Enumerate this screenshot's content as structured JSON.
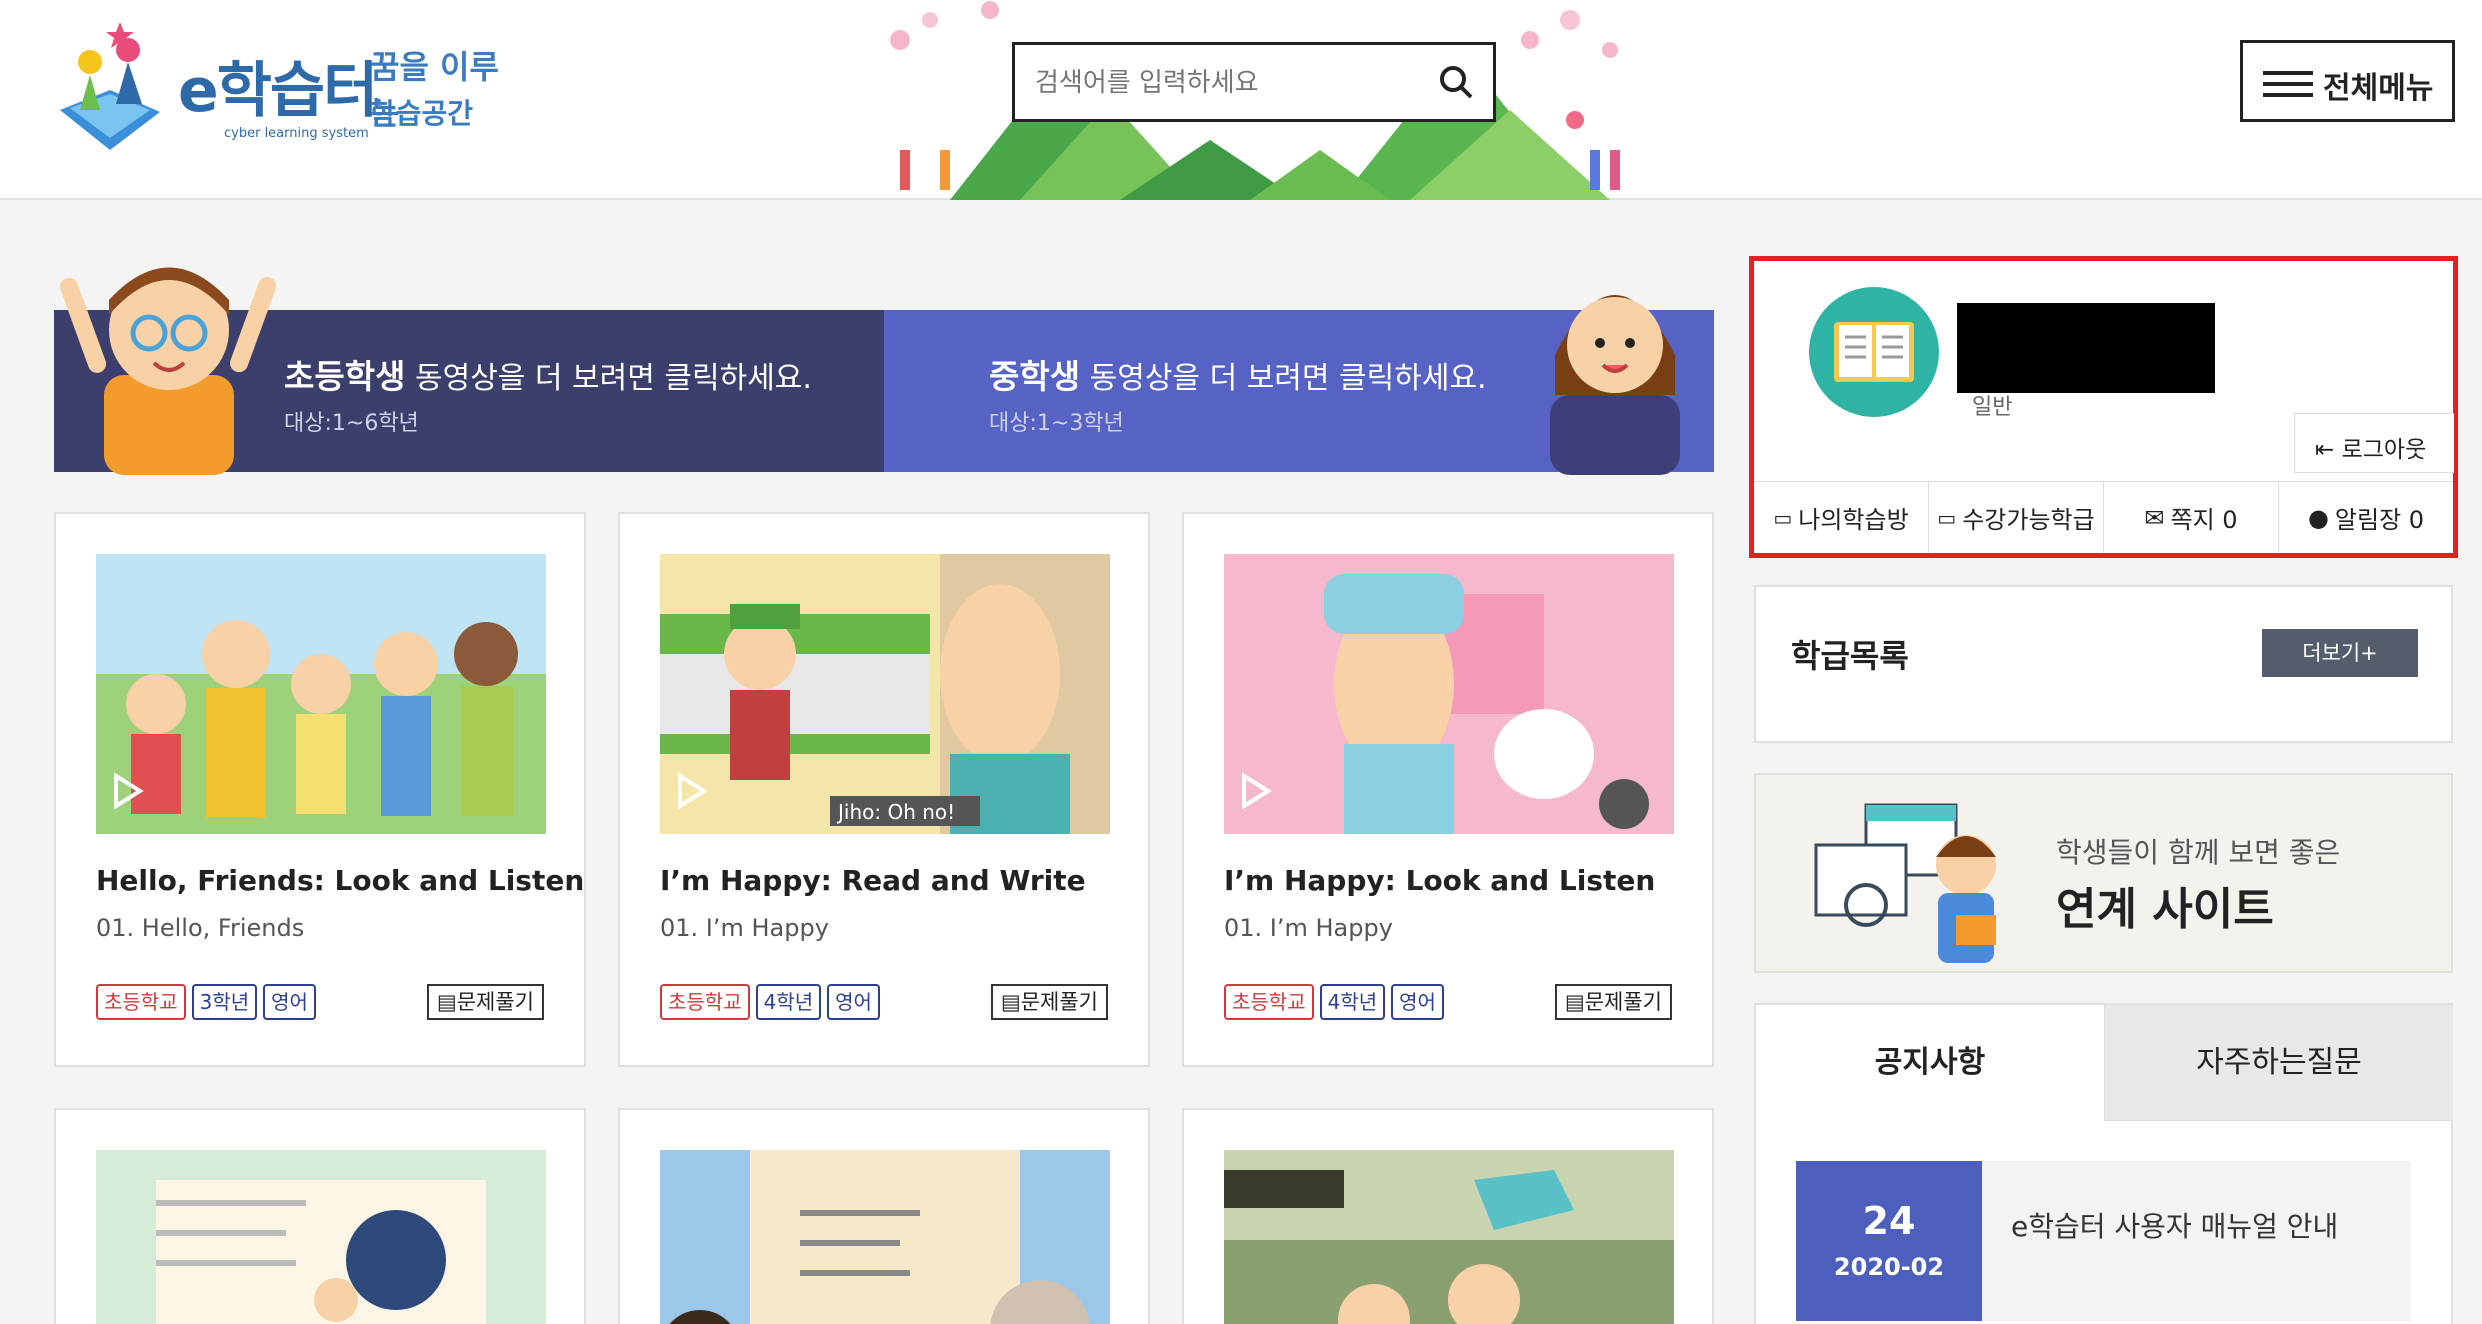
{
  "header": {
    "logo_text": "e학습터",
    "logo_sub": "cyber learning system",
    "slogan_line1": "꿈을 이루는",
    "slogan_line2": "학습공간",
    "search_placeholder": "검색어를 입력하세요",
    "menu_label": "전체메뉴"
  },
  "hero": {
    "left_title_bold": "초등학생",
    "left_title_rest": " 동영상을 더 보려면 클릭하세요.",
    "left_sub": "대상:1~6학년",
    "right_title_bold": "중학생",
    "right_title_rest": " 동영상을 더 보려면 클릭하세요.",
    "right_sub": "대상:1~3학년"
  },
  "cards": [
    {
      "title": "Hello, Friends: Look and Listen",
      "sub": "01. Hello, Friends",
      "tags": [
        "초등학교",
        "3학년",
        "영어"
      ],
      "quiz": "문제풀기",
      "thumb_caption": ""
    },
    {
      "title": "I’m Happy: Read and Write",
      "sub": "01. I’m Happy",
      "tags": [
        "초등학교",
        "4학년",
        "영어"
      ],
      "quiz": "문제풀기",
      "thumb_caption": "Jiho: Oh no!"
    },
    {
      "title": "I’m Happy: Look and Listen",
      "sub": "01. I’m Happy",
      "tags": [
        "초등학교",
        "4학년",
        "영어"
      ],
      "quiz": "문제풀기",
      "thumb_caption": ""
    }
  ],
  "profile": {
    "user_type": "일반",
    "logout": "로그아웃",
    "nav": [
      "나의학습방",
      "수강가능학급",
      "쪽지 0",
      "알림장 0"
    ]
  },
  "class_list": {
    "title": "학급목록",
    "more": "더보기+"
  },
  "link_sites": {
    "sub": "학생들이 함께 보면 좋은",
    "title": "연계 사이트"
  },
  "notice": {
    "tabs": [
      "공지사항",
      "자주하는질문"
    ],
    "items": [
      {
        "day": "24",
        "ym": "2020-02",
        "text": "e학습터 사용자 매뉴얼 안내"
      }
    ]
  },
  "colors": {
    "hero_left": "#3c3f6c",
    "hero_right": "#5763c4",
    "avatar": "#2fb3a5",
    "highlight": "#e62020",
    "date_box": "#4d5fbd"
  }
}
